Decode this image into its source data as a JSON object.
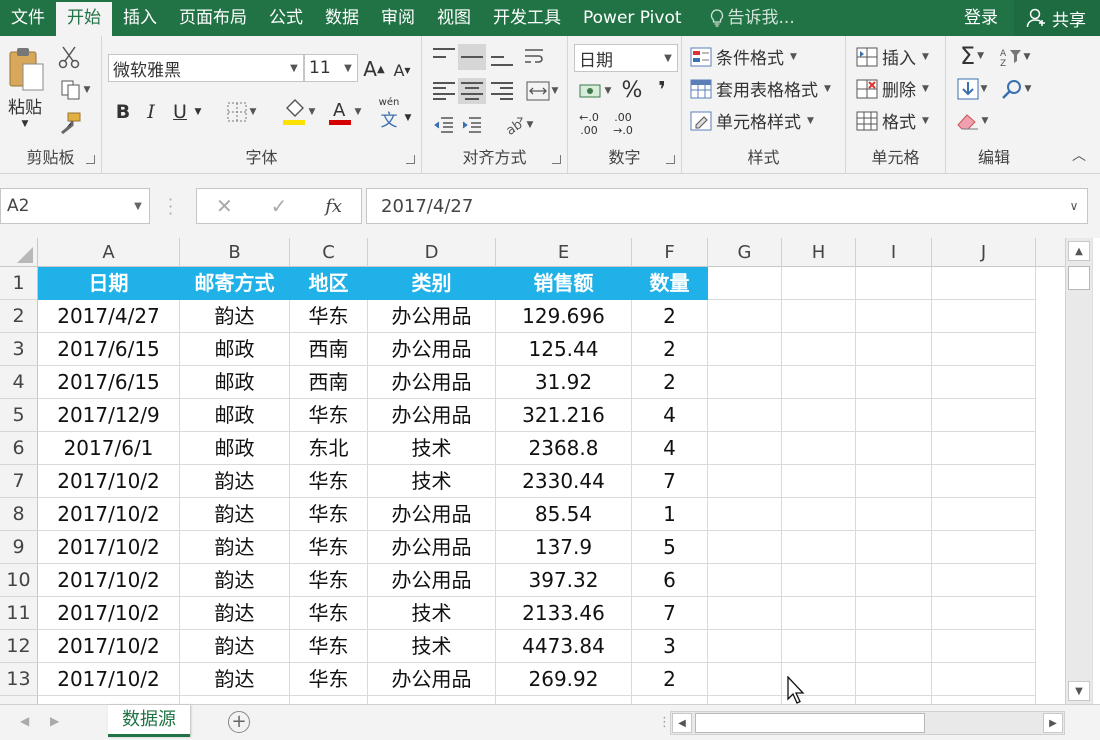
{
  "menu": {
    "tabs": [
      "文件",
      "开始",
      "插入",
      "页面布局",
      "公式",
      "数据",
      "审阅",
      "视图",
      "开发工具",
      "Power Pivot"
    ],
    "active_tab": "开始",
    "tell_me": "告诉我...",
    "login": "登录",
    "share": "共享"
  },
  "ribbon": {
    "clipboard": {
      "label": "剪贴板",
      "paste": "粘贴"
    },
    "font": {
      "label": "字体",
      "font_name": "微软雅黑",
      "font_size": "11",
      "bold": "B",
      "italic": "I",
      "underline": "U",
      "phonetic_top": "wén",
      "phonetic_bottom": "文"
    },
    "alignment": {
      "label": "对齐方式"
    },
    "number": {
      "label": "数字",
      "format": "日期",
      "percent": "%",
      "comma": "❜",
      "inc_decimal_top": "←.0",
      "inc_decimal_bottom": ".00",
      "dec_decimal_top": ".00",
      "dec_decimal_bottom": "→.0"
    },
    "styles": {
      "label": "样式",
      "conditional": "条件格式",
      "table": "套用表格格式",
      "cell": "单元格样式"
    },
    "cells": {
      "label": "单元格",
      "insert": "插入",
      "delete": "删除",
      "format": "格式"
    },
    "editing": {
      "label": "编辑"
    }
  },
  "formula_bar": {
    "name_box": "A2",
    "formula": "2017/4/27"
  },
  "columns": [
    "A",
    "B",
    "C",
    "D",
    "E",
    "F",
    "G",
    "H",
    "I",
    "J"
  ],
  "rows": [
    "1",
    "2",
    "3",
    "4",
    "5",
    "6",
    "7",
    "8",
    "9",
    "10",
    "11",
    "12",
    "13"
  ],
  "table": {
    "headers": [
      "日期",
      "邮寄方式",
      "地区",
      "类别",
      "销售额",
      "数量"
    ],
    "header_color": "#1fb1e8",
    "data": [
      [
        "2017/4/27",
        "韵达",
        "华东",
        "办公用品",
        "129.696",
        "2"
      ],
      [
        "2017/6/15",
        "邮政",
        "西南",
        "办公用品",
        "125.44",
        "2"
      ],
      [
        "2017/6/15",
        "邮政",
        "西南",
        "办公用品",
        "31.92",
        "2"
      ],
      [
        "2017/12/9",
        "邮政",
        "华东",
        "办公用品",
        "321.216",
        "4"
      ],
      [
        "2017/6/1",
        "邮政",
        "东北",
        "技术",
        "2368.8",
        "4"
      ],
      [
        "2017/10/2",
        "韵达",
        "华东",
        "技术",
        "2330.44",
        "7"
      ],
      [
        "2017/10/2",
        "韵达",
        "华东",
        "办公用品",
        "85.54",
        "1"
      ],
      [
        "2017/10/2",
        "韵达",
        "华东",
        "办公用品",
        "137.9",
        "5"
      ],
      [
        "2017/10/2",
        "韵达",
        "华东",
        "办公用品",
        "397.32",
        "6"
      ],
      [
        "2017/10/2",
        "韵达",
        "华东",
        "技术",
        "2133.46",
        "7"
      ],
      [
        "2017/10/2",
        "韵达",
        "华东",
        "技术",
        "4473.84",
        "3"
      ],
      [
        "2017/10/2",
        "韵达",
        "华东",
        "办公用品",
        "269.92",
        "2"
      ]
    ]
  },
  "sheets": {
    "active": "数据源"
  },
  "colors": {
    "excel_green": "#217346"
  }
}
